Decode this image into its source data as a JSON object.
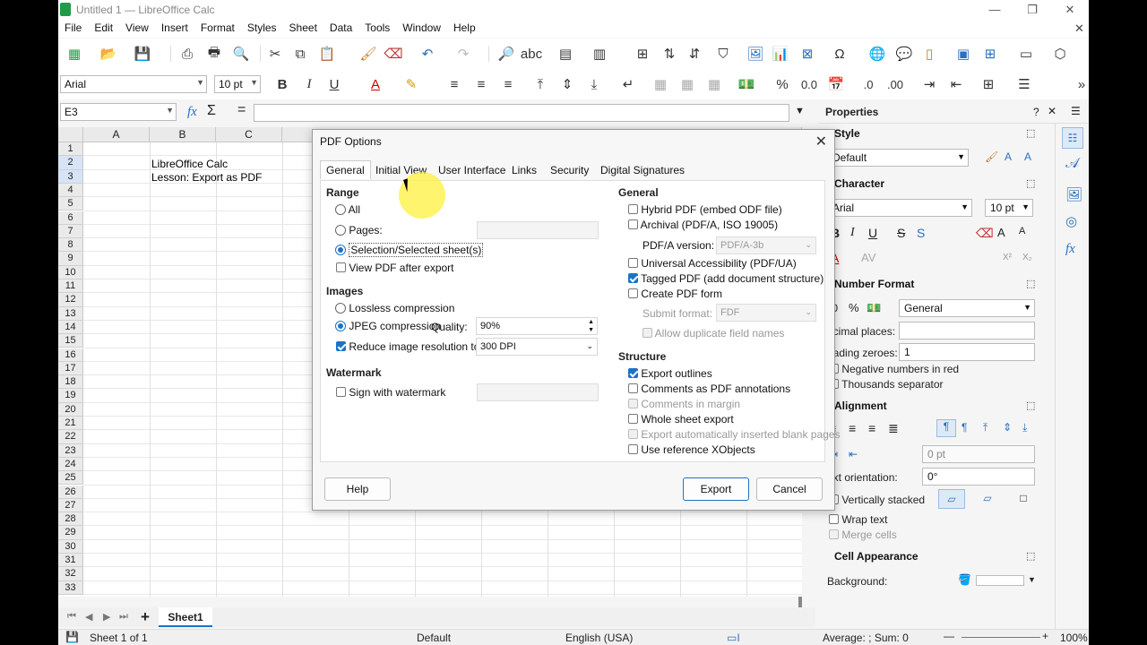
{
  "window": {
    "title": "Untitled 1 — LibreOffice Calc"
  },
  "menu": [
    "File",
    "Edit",
    "View",
    "Insert",
    "Format",
    "Styles",
    "Sheet",
    "Data",
    "Tools",
    "Window",
    "Help"
  ],
  "toolbar": {
    "font_name": "Arial",
    "font_size": "10 pt"
  },
  "formula_bar": {
    "name_box": "E3",
    "fx": "fx",
    "sigma": "Σ",
    "equals": "="
  },
  "grid": {
    "columns": [
      "A",
      "B",
      "C"
    ],
    "rows": [
      "1",
      "2",
      "3",
      "4",
      "5",
      "6",
      "7",
      "8",
      "9",
      "10",
      "11",
      "12",
      "13",
      "14",
      "15",
      "16",
      "17",
      "18",
      "19",
      "20",
      "21",
      "22",
      "23",
      "24",
      "25",
      "26",
      "27",
      "28",
      "29",
      "30",
      "31",
      "32",
      "33"
    ],
    "b2": "LibreOffice Calc",
    "b3": "Lesson: Export as PDF"
  },
  "sheet_tabs": {
    "add": "+",
    "active": "Sheet1"
  },
  "status": {
    "sheet": "Sheet 1 of 1",
    "style": "Default",
    "language": "English (USA)",
    "summary": "Average: ; Sum: 0",
    "zoom": "100%"
  },
  "sidebar": {
    "title": "Properties",
    "style_section": "Style",
    "style_value": "Default",
    "character_section": "Character",
    "char_font": "Arial",
    "char_size": "10 pt",
    "number_section": "Number Format",
    "number_format": "General",
    "decimal_label": "ecimal places:",
    "leading_label": "eading zeroes:",
    "leading_value": "1",
    "neg_red": "Negative numbers in red",
    "thousands": "Thousands separator",
    "alignment_section": "Alignment",
    "indent_value": "0 pt",
    "orientation_label": "ext orientation:",
    "orientation_value": "0°",
    "vertically_stacked": "Vertically stacked",
    "wrap_text": "Wrap text",
    "merge_cells": "Merge cells",
    "cell_appearance": "Cell Appearance",
    "background_label": "Background:"
  },
  "dialog": {
    "title": "PDF Options",
    "tabs": [
      "General",
      "Initial View",
      "User Interface",
      "Links",
      "Security",
      "Digital Signatures"
    ],
    "range": {
      "heading": "Range",
      "all": "All",
      "pages": "Pages:",
      "selection": "Selection/Selected sheet(s)",
      "view_after": "View PDF after export"
    },
    "images": {
      "heading": "Images",
      "lossless": "Lossless compression",
      "jpeg": "JPEG compression",
      "quality_label": "Quality:",
      "quality_value": "90%",
      "reduce": "Reduce image resolution to:",
      "resolution": "300 DPI"
    },
    "watermark": {
      "heading": "Watermark",
      "sign": "Sign with watermark"
    },
    "general": {
      "heading": "General",
      "hybrid": "Hybrid PDF (embed ODF file)",
      "archival": "Archival (PDF/A, ISO 19005)",
      "pdfa_label": "PDF/A version:",
      "pdfa_value": "PDF/A-3b",
      "ua": "Universal Accessibility (PDF/UA)",
      "tagged": "Tagged PDF (add document structure)",
      "form": "Create PDF form",
      "submit_label": "Submit format:",
      "submit_value": "FDF",
      "dup_fields": "Allow duplicate field names"
    },
    "structure": {
      "heading": "Structure",
      "outlines": "Export outlines",
      "comments_ann": "Comments as PDF annotations",
      "comments_margin": "Comments in margin",
      "whole_sheet": "Whole sheet export",
      "blank_pages": "Export automatically inserted blank pages",
      "xobjects": "Use reference XObjects"
    },
    "buttons": {
      "help": "Help",
      "export": "Export",
      "cancel": "Cancel"
    }
  }
}
